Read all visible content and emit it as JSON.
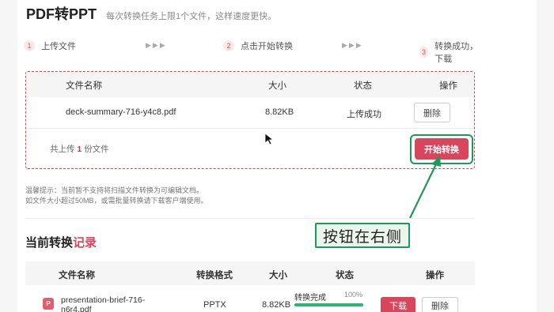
{
  "header": {
    "title": "PDF转PPT",
    "subtitle": "每次转换任务上限1个文件，这样速度更快。"
  },
  "steps": [
    {
      "num": "1",
      "label": "上传文件"
    },
    {
      "num": "2",
      "label": "点击开始转换"
    },
    {
      "num": "3",
      "label": "转换成功，下载"
    }
  ],
  "step_arrows": "▶▶▶",
  "upload": {
    "columns": {
      "name": "文件名称",
      "size": "大小",
      "status": "状态",
      "action": "操作"
    },
    "row": {
      "name": "deck-summary-716-y4c8.pdf",
      "size": "8.82KB",
      "status": "上传成功",
      "delete": "删除"
    },
    "footer_prefix": "共上传",
    "footer_count": "1",
    "footer_suffix": "份文件",
    "start_button": "开始转换"
  },
  "tip": {
    "line1": "温馨提示：当前暂不支持将扫描文件转换为可编辑文档。",
    "line2": "如文件大小超过50MB，或需批量转换请下载客户端使用。"
  },
  "history": {
    "title_plain": "当前转换",
    "title_accent": "记录",
    "columns": {
      "name": "文件名称",
      "format": "转换格式",
      "size": "大小",
      "status": "状态",
      "action": "操作"
    },
    "row": {
      "file_icon": "P",
      "name": "presentation-brief-716-n6r4.pdf",
      "format": "PPTX",
      "size": "8.82KB",
      "status": "转换完成",
      "progress_label": "100%",
      "progress": 100,
      "download": "下载",
      "delete": "删除"
    }
  },
  "annotation": {
    "callout": "按钮在右侧"
  },
  "colors": {
    "accent": "#d9455a",
    "annotation_green": "#1b9a5a",
    "progress_green": "#2bb673"
  }
}
